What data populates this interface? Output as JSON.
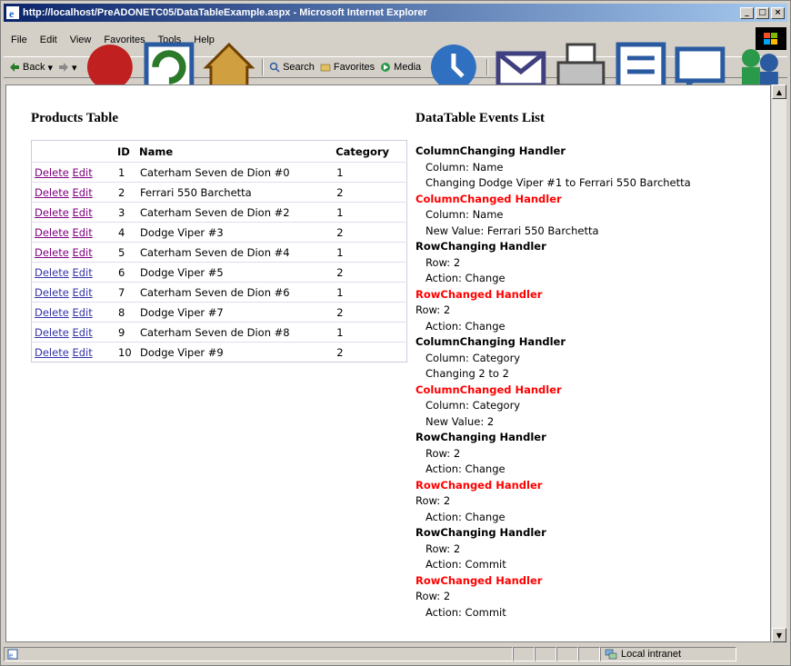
{
  "window": {
    "title": "http://localhost/PreADONETC05/DataTableExample.aspx - Microsoft Internet Explorer",
    "buttons": [
      "_",
      "□",
      "×"
    ]
  },
  "menu": [
    "File",
    "Edit",
    "View",
    "Favorites",
    "Tools",
    "Help"
  ],
  "toolbar": {
    "back": "Back",
    "search": "Search",
    "favorites": "Favorites",
    "media": "Media"
  },
  "status": {
    "zone": "Local intranet"
  },
  "products": {
    "heading": "Products Table",
    "columns": [
      "",
      "ID",
      "Name",
      "Category"
    ],
    "delete_label": "Delete",
    "edit_label": "Edit",
    "rows": [
      {
        "id": "1",
        "name": "Caterham Seven de Dion #0",
        "category": "1"
      },
      {
        "id": "2",
        "name": "Ferrari 550 Barchetta",
        "category": "2"
      },
      {
        "id": "3",
        "name": "Caterham Seven de Dion #2",
        "category": "1"
      },
      {
        "id": "4",
        "name": "Dodge Viper #3",
        "category": "2"
      },
      {
        "id": "5",
        "name": "Caterham Seven de Dion #4",
        "category": "1"
      },
      {
        "id": "6",
        "name": "Dodge Viper #5",
        "category": "2"
      },
      {
        "id": "7",
        "name": "Caterham Seven de Dion #6",
        "category": "1"
      },
      {
        "id": "8",
        "name": "Dodge Viper #7",
        "category": "2"
      },
      {
        "id": "9",
        "name": "Caterham Seven de Dion #8",
        "category": "1"
      },
      {
        "id": "10",
        "name": "Dodge Viper #9",
        "category": "2"
      }
    ]
  },
  "events": {
    "heading": "DataTable Events List",
    "lines": [
      {
        "text": "ColumnChanging Handler",
        "kind": "head"
      },
      {
        "text": "Column: Name",
        "kind": "indent"
      },
      {
        "text": "Changing Dodge Viper #1 to Ferrari 550 Barchetta",
        "kind": "indent"
      },
      {
        "text": "ColumnChanged Handler",
        "kind": "head-red"
      },
      {
        "text": "Column: Name",
        "kind": "indent"
      },
      {
        "text": "New Value: Ferrari 550 Barchetta",
        "kind": "indent"
      },
      {
        "text": "RowChanging Handler",
        "kind": "head"
      },
      {
        "text": "Row: 2",
        "kind": "indent"
      },
      {
        "text": "Action: Change",
        "kind": "indent"
      },
      {
        "text": "RowChanged Handler",
        "kind": "head-red"
      },
      {
        "text": "Row: 2",
        "kind": "plain"
      },
      {
        "text": "Action: Change",
        "kind": "indent"
      },
      {
        "text": "ColumnChanging Handler",
        "kind": "head"
      },
      {
        "text": "Column: Category",
        "kind": "indent"
      },
      {
        "text": "Changing 2 to 2",
        "kind": "indent"
      },
      {
        "text": "ColumnChanged Handler",
        "kind": "head-red"
      },
      {
        "text": "Column: Category",
        "kind": "indent"
      },
      {
        "text": "New Value: 2",
        "kind": "indent"
      },
      {
        "text": "RowChanging Handler",
        "kind": "head"
      },
      {
        "text": "Row: 2",
        "kind": "indent"
      },
      {
        "text": "Action: Change",
        "kind": "indent"
      },
      {
        "text": "RowChanged Handler",
        "kind": "head-red"
      },
      {
        "text": "Row: 2",
        "kind": "plain"
      },
      {
        "text": "Action: Change",
        "kind": "indent"
      },
      {
        "text": "RowChanging Handler",
        "kind": "head"
      },
      {
        "text": "Row: 2",
        "kind": "indent"
      },
      {
        "text": "Action: Commit",
        "kind": "indent"
      },
      {
        "text": "RowChanged Handler",
        "kind": "head-red"
      },
      {
        "text": "Row: 2",
        "kind": "plain"
      },
      {
        "text": "Action: Commit",
        "kind": "indent"
      }
    ]
  },
  "colors": {
    "link": "#3333aa",
    "visited": "#800080",
    "handler_red": "#ff0000",
    "titlebar": "#0a246a"
  }
}
